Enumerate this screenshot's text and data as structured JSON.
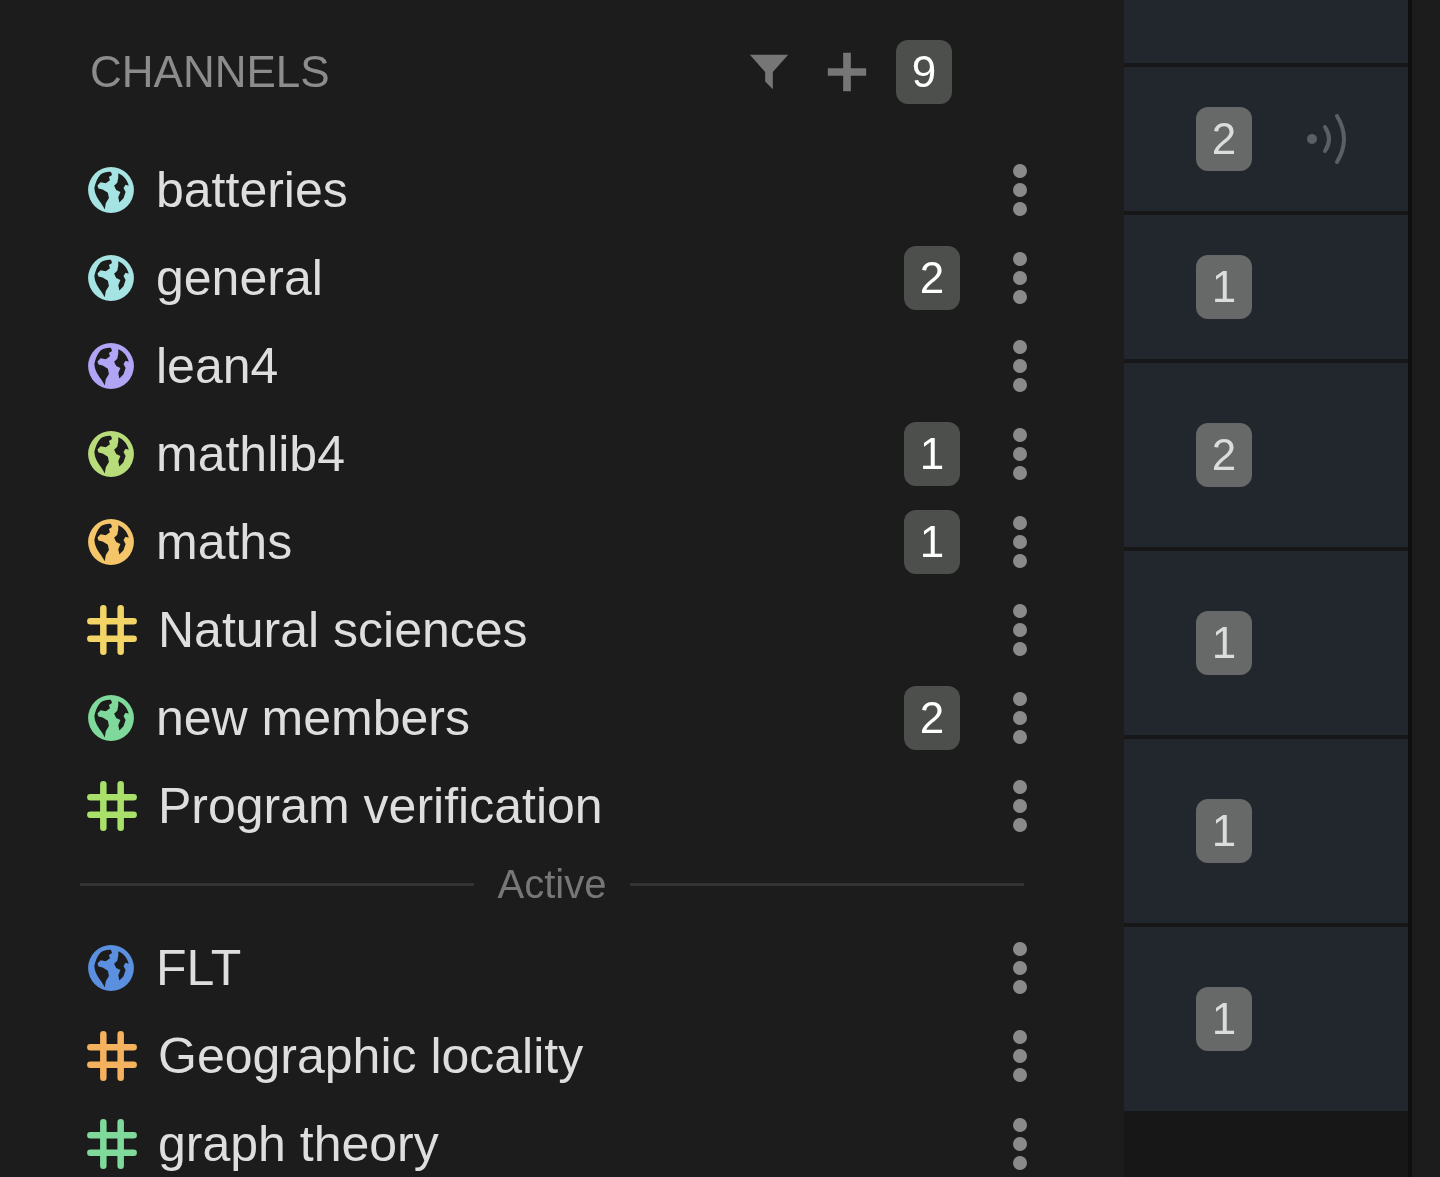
{
  "channels_panel": {
    "title": "CHANNELS",
    "count": "9",
    "channels": [
      {
        "kind": "globe",
        "color": "#a6e3e3",
        "name": "batteries"
      },
      {
        "kind": "globe",
        "color": "#a6e3e3",
        "name": "general",
        "unread": "2"
      },
      {
        "kind": "globe",
        "color": "#b0a4f5",
        "name": "lean4"
      },
      {
        "kind": "globe",
        "color": "#b8dc7a",
        "name": "mathlib4",
        "unread": "1"
      },
      {
        "kind": "globe",
        "color": "#f5c56a",
        "name": "maths",
        "unread": "1"
      },
      {
        "kind": "hash",
        "color": "#f2d566",
        "name": "Natural sciences"
      },
      {
        "kind": "globe",
        "color": "#7fd99a",
        "name": "new members",
        "unread": "2"
      },
      {
        "kind": "hash",
        "color": "#a9e06a",
        "name": "Program verification"
      }
    ],
    "divider": "Active",
    "active_channels": [
      {
        "kind": "globe",
        "color": "#5b8fe0",
        "name": "FLT"
      },
      {
        "kind": "hash",
        "color": "#f5b25e",
        "name": "Geographic locality"
      },
      {
        "kind": "hash",
        "color": "#7fd99a",
        "name": "graph theory"
      }
    ]
  },
  "topic_rows": [
    {
      "unread": "2",
      "live": true
    },
    {
      "unread": "1",
      "live": false
    },
    {
      "unread": "2",
      "live": false
    },
    {
      "unread": "1",
      "live": false
    },
    {
      "unread": "1",
      "live": false
    },
    {
      "unread": "1",
      "live": false
    }
  ]
}
